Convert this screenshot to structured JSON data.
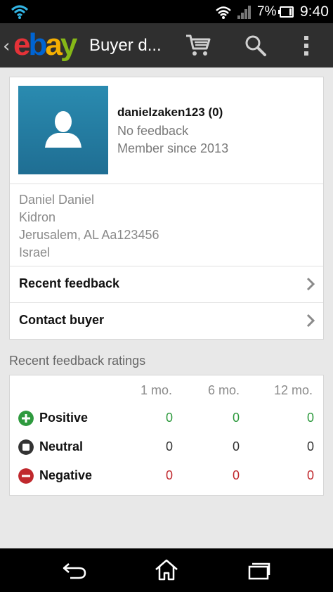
{
  "status_bar": {
    "battery_percent": "7%",
    "time": "9:40"
  },
  "action_bar": {
    "logo_letters": [
      "e",
      "b",
      "a",
      "y"
    ],
    "title": "Buyer d...",
    "icons": [
      "back-chevron-icon",
      "cart-icon",
      "search-icon",
      "overflow-menu-icon"
    ]
  },
  "buyer": {
    "username": "danielzaken123 (0)",
    "feedback_status": "No feedback",
    "member_since": "Member since 2013",
    "address": {
      "line1": "Daniel Daniel",
      "line2": "Kidron",
      "line3": "Jerusalem, AL Aa123456",
      "line4": "Israel"
    }
  },
  "actions": {
    "recent_feedback": "Recent feedback",
    "contact_buyer": "Contact buyer"
  },
  "ratings": {
    "section_title": "Recent feedback ratings",
    "columns": [
      "1 mo.",
      "6 mo.",
      "12 mo."
    ],
    "rows": [
      {
        "label": "Positive",
        "values": [
          "0",
          "0",
          "0"
        ],
        "color": "#2e9a3e",
        "icon": "plus-circle-icon"
      },
      {
        "label": "Neutral",
        "values": [
          "0",
          "0",
          "0"
        ],
        "color": "#333333",
        "icon": "square-circle-icon"
      },
      {
        "label": "Negative",
        "values": [
          "0",
          "0",
          "0"
        ],
        "color": "#c0282d",
        "icon": "minus-circle-icon"
      }
    ]
  },
  "colors": {
    "ebay_red": "#e53238",
    "ebay_blue": "#0064d2",
    "ebay_yellow": "#f5af02",
    "ebay_green": "#86b817",
    "avatar_blue": "#2a8bb0"
  },
  "nav_bar": {
    "icons": [
      "back-icon",
      "home-icon",
      "recents-icon"
    ]
  }
}
